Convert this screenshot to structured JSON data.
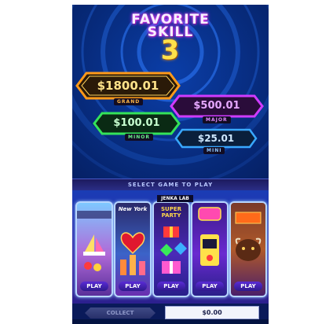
{
  "game": {
    "title_line1": "FAVORITE",
    "title_line2": "SKILL",
    "title_number": "3"
  },
  "jackpots": {
    "grand": {
      "amount": "$1800.01",
      "label": "GRAND",
      "color": "#ff9a1a"
    },
    "major": {
      "amount": "$500.01",
      "label": "MAJOR",
      "color": "#d03bff"
    },
    "minor": {
      "amount": "$100.01",
      "label": "MINOR",
      "color": "#34e25a"
    },
    "mini": {
      "amount": "$25.01",
      "label": "MINI",
      "color": "#39a8ff"
    }
  },
  "select_label": "SELECT GAME TO PLAY",
  "games": [
    {
      "name": "",
      "play_label": "PLAY",
      "glyph": "sailboat-icon"
    },
    {
      "name": "New York",
      "play_label": "PLAY",
      "glyph": "heart-icon"
    },
    {
      "name": "SUPER PARTY",
      "play_label": "PLAY",
      "glyph": "gift-icon"
    },
    {
      "name": "",
      "play_label": "PLAY",
      "glyph": "slot-machine-icon"
    },
    {
      "name": "",
      "play_label": "PLAY",
      "glyph": "buffalo-icon"
    }
  ],
  "jenka_label": "JENKA LAB",
  "footer": {
    "collect_label": "COLLECT",
    "balance": "$0.00"
  }
}
